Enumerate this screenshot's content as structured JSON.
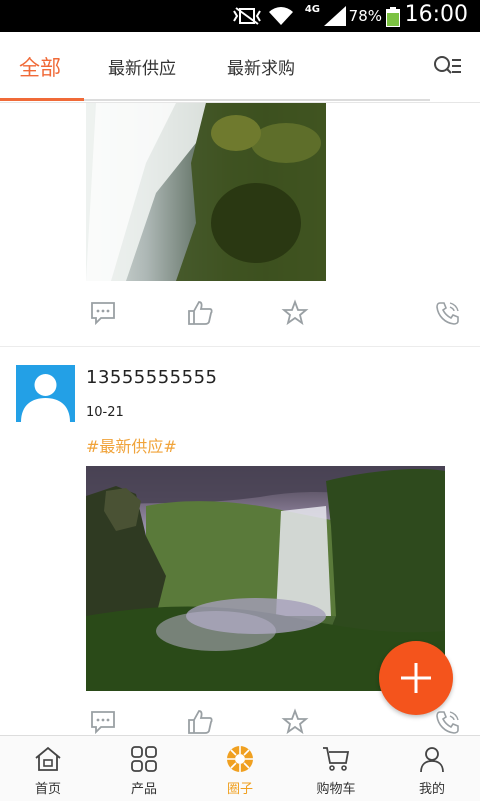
{
  "status_bar": {
    "battery": "78%",
    "time": "16:00",
    "network": "4G"
  },
  "tabs": [
    {
      "label": "全部",
      "active": true
    },
    {
      "label": "最新供应",
      "active": false
    },
    {
      "label": "最新求购",
      "active": false
    }
  ],
  "post": {
    "username": "13555555555",
    "date": "10-21",
    "tag": "#最新供应#"
  },
  "bottom_nav": [
    {
      "label": "首页",
      "icon": "home-icon"
    },
    {
      "label": "产品",
      "icon": "grid-icon"
    },
    {
      "label": "圈子",
      "icon": "aperture-icon",
      "active": true
    },
    {
      "label": "购物车",
      "icon": "cart-icon"
    },
    {
      "label": "我的",
      "icon": "person-icon"
    }
  ],
  "colors": {
    "accent": "#f06a38",
    "fab": "#f4541c",
    "tag": "#f0a33a",
    "avatar": "#23a0e6",
    "nav_active": "#f0a020"
  }
}
